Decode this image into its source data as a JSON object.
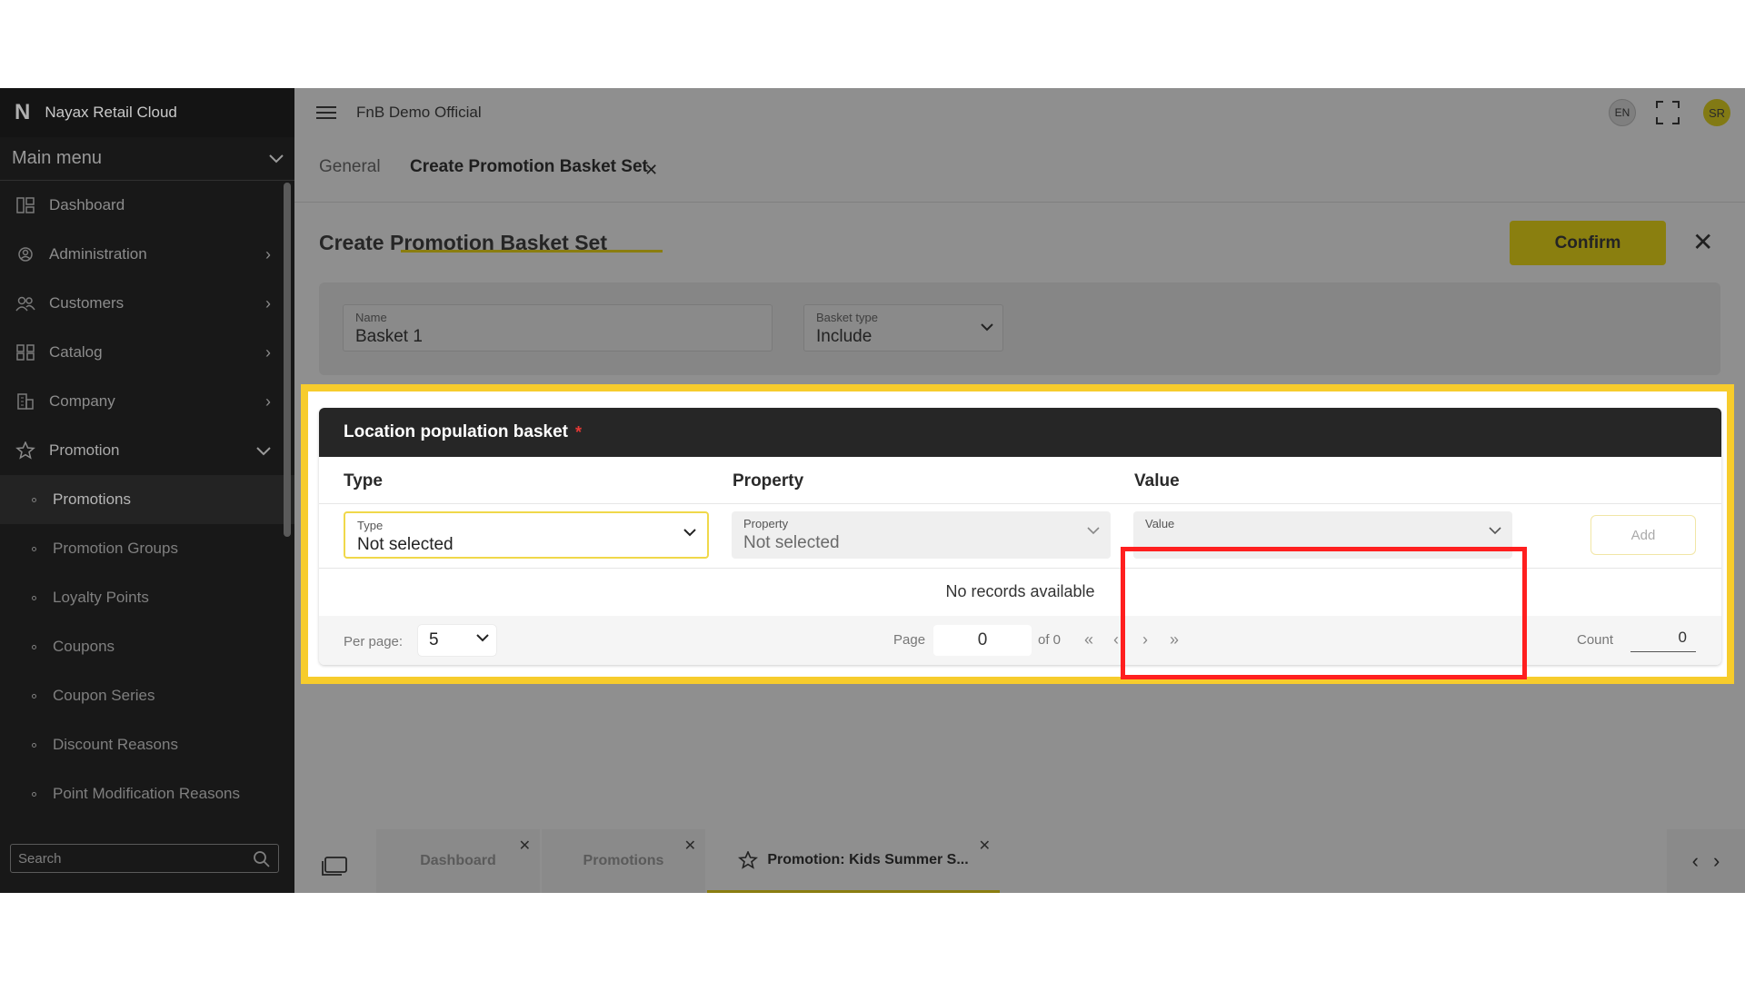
{
  "sidebar": {
    "brand": "Nayax Retail Cloud",
    "main_menu": "Main menu",
    "items": [
      {
        "label": "Dashboard"
      },
      {
        "label": "Administration"
      },
      {
        "label": "Customers"
      },
      {
        "label": "Catalog"
      },
      {
        "label": "Company"
      },
      {
        "label": "Promotion"
      }
    ],
    "sub_items": [
      {
        "label": "Promotions"
      },
      {
        "label": "Promotion Groups"
      },
      {
        "label": "Loyalty Points"
      },
      {
        "label": "Coupons"
      },
      {
        "label": "Coupon Series"
      },
      {
        "label": "Discount Reasons"
      },
      {
        "label": "Point Modification Reasons"
      }
    ],
    "search_placeholder": "Search"
  },
  "header": {
    "org": "FnB Demo Official",
    "lang": "EN",
    "user_initials": "SR"
  },
  "tabs": {
    "general": "General",
    "active": "Create Promotion Basket Set"
  },
  "page": {
    "title": "Create Promotion Basket Set",
    "confirm_label": "Confirm"
  },
  "form": {
    "name_label": "Name",
    "name_value": "Basket 1",
    "basket_type_label": "Basket type",
    "basket_type_value": "Include"
  },
  "basket": {
    "title": "Location population basket",
    "required_mark": "*",
    "col_type": "Type",
    "col_property": "Property",
    "col_value": "Value",
    "type_label": "Type",
    "type_value": "Not selected",
    "property_label": "Property",
    "property_value": "Not selected",
    "value_label": "Value",
    "add_label": "Add",
    "empty_text": "No records available",
    "per_page_label": "Per page:",
    "per_page_value": "5",
    "page_label": "Page",
    "page_value": "0",
    "of_label": "of 0",
    "count_label": "Count",
    "count_value": "0"
  },
  "bottom_tabs": [
    {
      "label": "Dashboard"
    },
    {
      "label": "Promotions"
    },
    {
      "label": "Promotion: Kids Summer S..."
    }
  ],
  "colors": {
    "accent": "#8a7f0f",
    "highlight_frame": "#f7cc2c",
    "annotation_box": "#ff1f1f"
  }
}
